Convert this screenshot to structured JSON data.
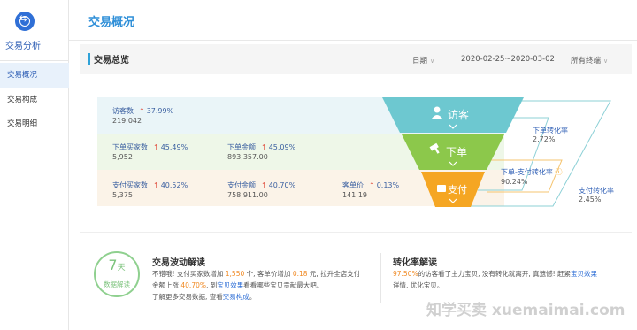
{
  "sidebar": {
    "title": "交易分析",
    "items": [
      {
        "label": "交易概况",
        "active": true
      },
      {
        "label": "交易构成",
        "active": false
      },
      {
        "label": "交易明细",
        "active": false
      }
    ]
  },
  "header": {
    "title": "交易概况"
  },
  "section": {
    "title": "交易总览",
    "date_label": "日期",
    "date_range": "2020-02-25~2020-03-02",
    "terminal": "所有终端"
  },
  "funnel": {
    "visitors": {
      "label": "访客数",
      "pct": "37.99%",
      "value": "219,042"
    },
    "order_buyers": {
      "label": "下单买家数",
      "pct": "45.49%",
      "value": "5,952"
    },
    "order_amount": {
      "label": "下单金额",
      "pct": "45.09%",
      "value": "893,357.00"
    },
    "pay_buyers": {
      "label": "支付买家数",
      "pct": "40.52%",
      "value": "5,375"
    },
    "pay_amount": {
      "label": "支付金额",
      "pct": "40.70%",
      "value": "758,911.00"
    },
    "unit_price": {
      "label": "客单价",
      "pct": "0.13%",
      "value": "141.19"
    },
    "stage_visit": "访客",
    "stage_order": "下单",
    "stage_pay": "支付",
    "up_arrow": "↑",
    "colors": {
      "visit": "#6dc8d0",
      "order": "#8cc84b",
      "pay": "#f5a623"
    }
  },
  "rates": {
    "order_conv": {
      "label": "下单转化率",
      "value": "2.72%"
    },
    "order_pay_conv": {
      "label": "下单-支付转化率",
      "value": "90.24%"
    },
    "pay_conv": {
      "label": "支付转化率",
      "value": "2.45%"
    }
  },
  "badge": {
    "num": "7",
    "unit": "天",
    "text": "数据解读"
  },
  "fluctuation": {
    "title": "交易波动解读",
    "p1": "不错哦! 支付买家数增加",
    "v1": "1,550",
    "p2": "个, 客单价增加",
    "v2": "0.18",
    "p3": "元, 拉升全店支付",
    "p4": "金额上涨",
    "v3": "40.70%",
    "p5": ", 到",
    "link1": "宝贝效果",
    "p6": "看看哪些宝贝贡献最大吧。",
    "p7": "了解更多交易数据, 查看",
    "link2": "交易构成",
    "p8": "。"
  },
  "conversion": {
    "title": "转化率解读",
    "v1": "97.50%",
    "p1": "的访客看了主力宝贝, 没有转化就离开, 真遗憾! 赶紧",
    "link1": "宝贝效果",
    "p2": "详情, 优化宝贝。"
  },
  "watermark": "知学买卖 xuemaimai.com"
}
